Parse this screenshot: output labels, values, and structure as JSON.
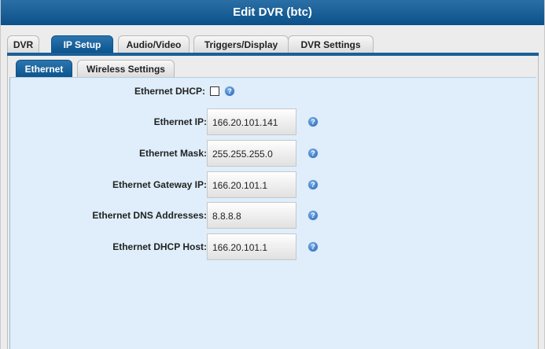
{
  "dialog": {
    "title": "Edit DVR (btc)"
  },
  "tabs": [
    {
      "label": "DVR"
    },
    {
      "label": "IP Setup",
      "active": true
    },
    {
      "label": "Audio/Video"
    },
    {
      "label": "Triggers/Display"
    },
    {
      "label": "DVR Settings"
    }
  ],
  "subtabs": [
    {
      "label": "Ethernet",
      "active": true
    },
    {
      "label": "Wireless Settings"
    }
  ],
  "form": {
    "dhcp": {
      "label": "Ethernet DHCP:",
      "checked": false
    },
    "ip": {
      "label": "Ethernet IP:",
      "value": "166.20.101.141"
    },
    "mask": {
      "label": "Ethernet Mask:",
      "value": "255.255.255.0"
    },
    "gateway": {
      "label": "Ethernet Gateway IP:",
      "value": "166.20.101.1"
    },
    "dns": {
      "label": "Ethernet DNS Addresses:",
      "value": "8.8.8.8"
    },
    "dhcp_host": {
      "label": "Ethernet DHCP Host:",
      "value": "166.20.101.1"
    }
  },
  "icons": {
    "help": "help-icon",
    "help_glyph": "?"
  },
  "colors": {
    "accent": "#0b5089",
    "content_bg": "#dfeefa"
  }
}
